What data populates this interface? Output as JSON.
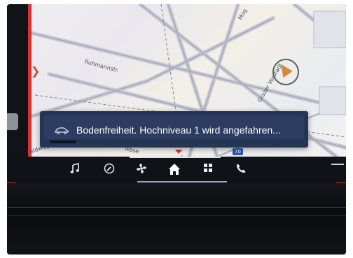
{
  "map": {
    "streets": [
      "Ruhmannstr.",
      "Grazer Vorstadt",
      "Mog",
      "lesse",
      "eldweg"
    ],
    "route_marker": "70"
  },
  "notification": {
    "icon": "car-lift-icon",
    "text": "Bodenfreiheit. Hochniveau 1 wird angefahren..."
  },
  "dock": {
    "items": [
      {
        "name": "media",
        "icon": "music-note-icon"
      },
      {
        "name": "navigation",
        "icon": "compass-icon"
      },
      {
        "name": "climate",
        "icon": "fan-icon"
      },
      {
        "name": "home",
        "icon": "home-icon"
      },
      {
        "name": "apps",
        "icon": "grid-icon"
      },
      {
        "name": "phone",
        "icon": "phone-icon"
      }
    ]
  },
  "colors": {
    "toast_bg": "#2c3d61",
    "accent_red": "#d8312f",
    "dock_bg": "#101217",
    "position_arrow": "#d18a3d"
  }
}
